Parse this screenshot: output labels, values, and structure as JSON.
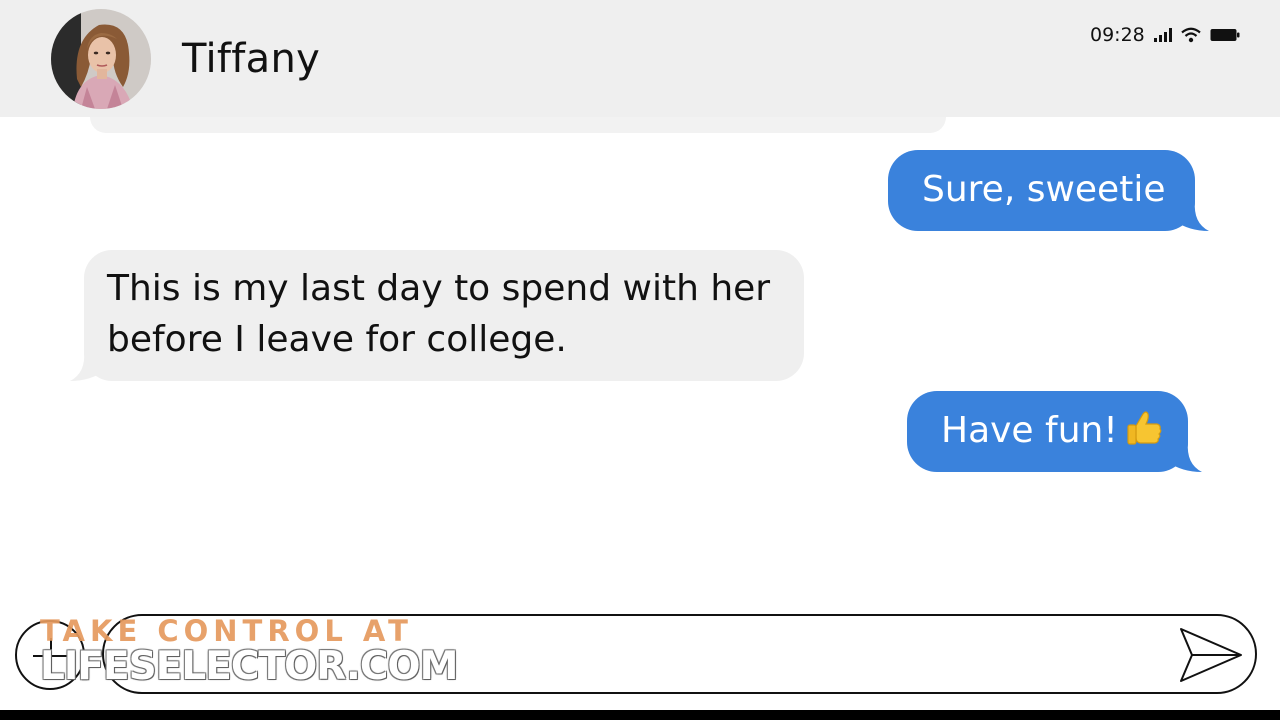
{
  "header": {
    "contact_name": "Tiffany",
    "avatar": "contact-photo"
  },
  "status_bar": {
    "time": "09:28",
    "icons": [
      "signal-icon",
      "wifi-icon",
      "battery-icon"
    ]
  },
  "messages": [
    {
      "direction": "outgoing",
      "text": "Sure, sweetie"
    },
    {
      "direction": "incoming",
      "lines": [
        "This is my last day to spend with her",
        "before I leave for college."
      ]
    },
    {
      "direction": "outgoing",
      "text": "Have fun!",
      "emoji": "thumbs-up-icon"
    }
  ],
  "composer": {
    "value": "",
    "add_icon": "plus-icon",
    "send_icon": "send-icon"
  },
  "watermark": {
    "line1": "TAKE CONTROL AT",
    "line2": "LIFESELECTOR.COM"
  },
  "colors": {
    "outgoing_bubble": "#3a82dc",
    "incoming_bubble": "#efefef",
    "header_bg": "#efefef",
    "watermark_accent": "#e69a5e"
  }
}
